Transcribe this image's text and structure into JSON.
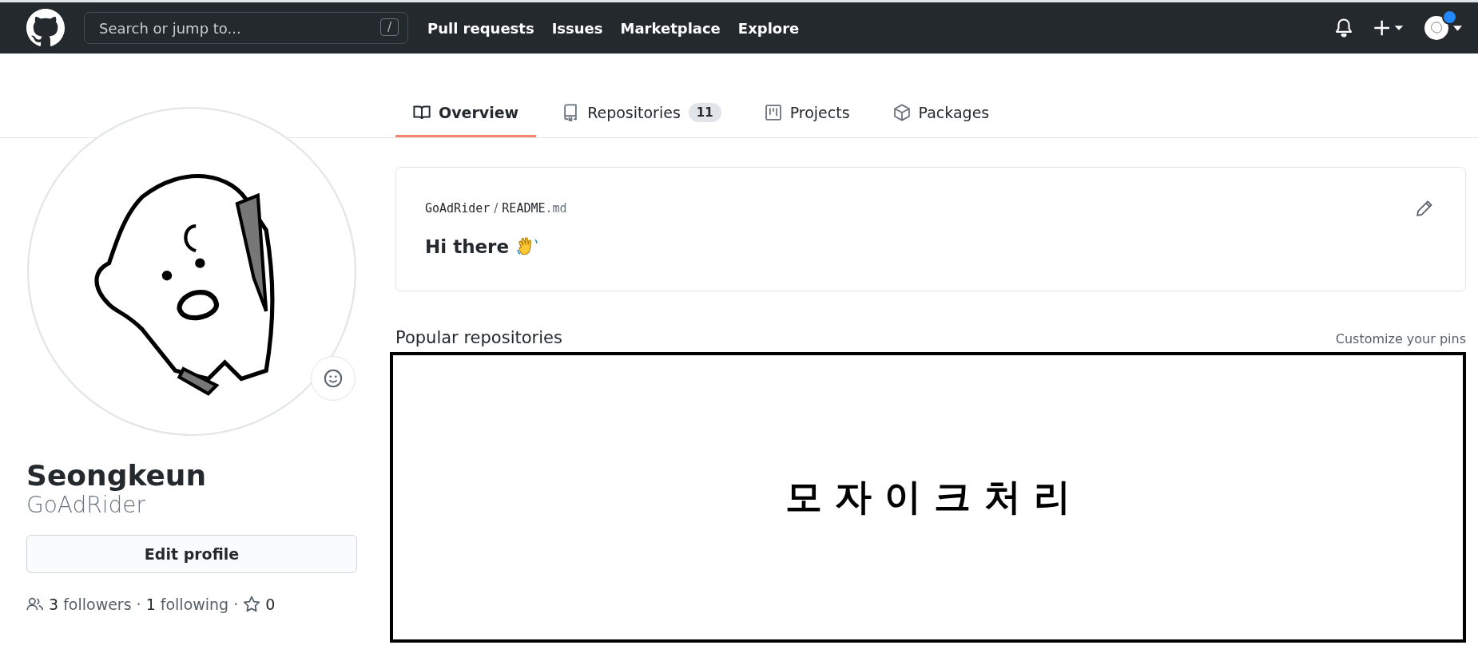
{
  "header": {
    "search": {
      "placeholder": "Search or jump to...",
      "shortcut": "/"
    },
    "nav": [
      "Pull requests",
      "Issues",
      "Marketplace",
      "Explore"
    ],
    "notification_dot": true
  },
  "tabs": [
    {
      "label": "Overview",
      "kind": "book",
      "selected": true
    },
    {
      "label": "Repositories",
      "kind": "repo",
      "count": "11",
      "selected": false
    },
    {
      "label": "Projects",
      "kind": "project",
      "selected": false
    },
    {
      "label": "Packages",
      "kind": "package",
      "selected": false
    }
  ],
  "profile": {
    "name": "Seongkeun",
    "username": "GoAdRider",
    "edit_button": "Edit profile",
    "followers_count": "3",
    "followers_label": "followers",
    "following_count": "1",
    "following_label": "following",
    "stars": "0",
    "separators": [
      "·",
      "·"
    ]
  },
  "readme": {
    "owner": "GoAdRider",
    "separator": "/",
    "file": "README",
    "extension": ".md",
    "heading": "Hi there"
  },
  "popular": {
    "title": "Popular repositories",
    "customize_link": "Customize your pins",
    "mosaic_label": "모 자 이 크 처 리"
  }
}
